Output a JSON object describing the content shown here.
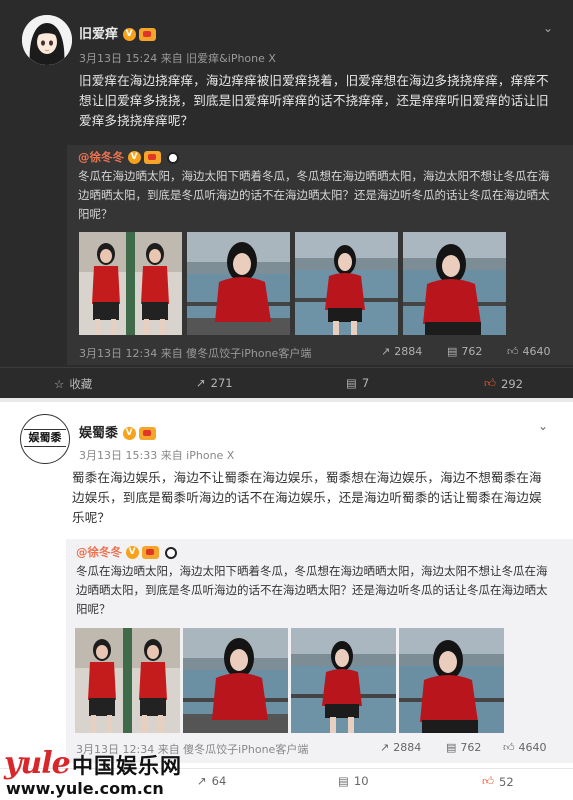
{
  "post1": {
    "username": "旧爱痒",
    "meta": "3月13日 15:24 来自 旧爱痒&iPhone X",
    "text": "旧爱痒在海边挠痒痒，海边痒痒被旧爱痒挠着，旧爱痒想在海边多挠挠痒痒，痒痒不想让旧爱痒多挠挠，到底是旧爱痒听痒痒的话不挠痒痒，还是痒痒听旧爱痒的话让旧爱痒多挠挠痒痒呢？",
    "repost_user": "@徐冬冬",
    "repost_text": "冬瓜在海边晒太阳，海边太阳下晒着冬瓜，冬瓜想在海边晒晒太阳，海边太阳不想让冬瓜在海边晒晒太阳，到底是冬瓜听海边的话不在海边晒太阳？还是海边听冬瓜的话让冬瓜在海边晒太阳呢？",
    "repost_meta": "3月13日 12:34 来自 傻冬瓜饺子iPhone客户端",
    "repost_stats": {
      "forward": "2884",
      "comment": "762",
      "like": "4640"
    },
    "actions": {
      "favorite": "收藏",
      "forward": "271",
      "comment": "7",
      "like": "292"
    }
  },
  "post2": {
    "username": "娱蜀黍",
    "avatar_text": "娱蜀黍",
    "meta": "3月13日 15:33 来自 iPhone X",
    "text": "蜀黍在海边娱乐，海边不让蜀黍在海边娱乐，蜀黍想在海边娱乐，海边不想蜀黍在海边娱乐，到底是蜀黍听海边的话不在海边娱乐，还是海边听蜀黍的话让蜀黍在海边娱乐呢？",
    "repost_user": "@徐冬冬",
    "repost_text": "冬瓜在海边晒太阳，海边太阳下晒着冬瓜，冬瓜想在海边晒晒太阳，海边太阳不想让冬瓜在海边晒晒太阳，到底是冬瓜听海边的话不在海边晒太阳？还是海边听冬瓜的话让冬瓜在海边晒太阳呢？",
    "repost_meta": "3月13日 12:34 来自 傻冬瓜饺子iPhone客户端",
    "repost_stats": {
      "forward": "2884",
      "comment": "762",
      "like": "4640"
    },
    "actions": {
      "forward": "64",
      "comment": "10",
      "like": "52"
    }
  },
  "watermark": {
    "brand": "yule",
    "cn": "中国娱乐网",
    "url": "www.yule.com.cn"
  },
  "colors": {
    "dark_bg": "#2b2b2b",
    "repost_dark": "#353535",
    "accent": "#eb7350",
    "like": "#e8552e"
  }
}
